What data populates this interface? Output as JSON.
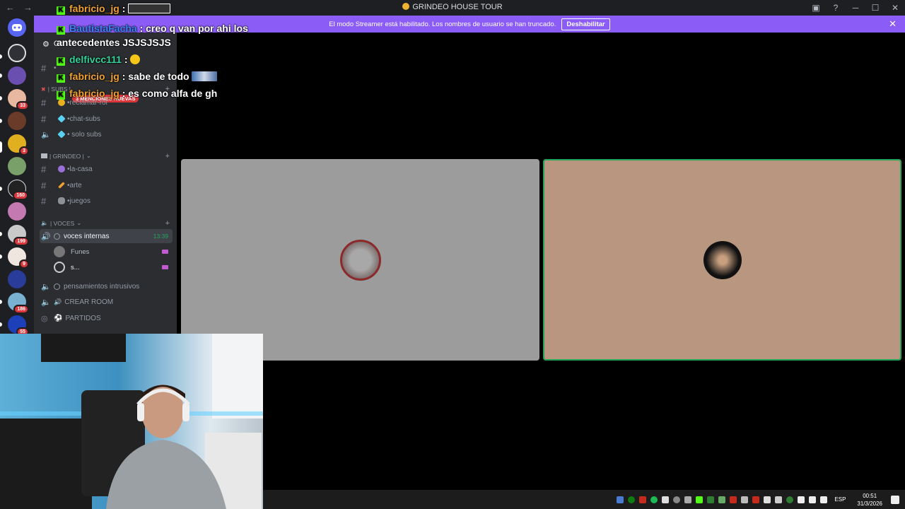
{
  "window": {
    "title": "GRINDEO HOUSE TOUR",
    "back_glyph": "←",
    "forward_glyph": "→",
    "controls": [
      "─",
      "☐",
      "✕"
    ]
  },
  "streamer_banner": {
    "text": "El modo Streamer está habilitado. Los nombres de usuario se han truncado.",
    "button": "Deshabilitar",
    "close": "✕"
  },
  "server_rail": {
    "badges": [
      "33",
      "3",
      "160",
      "199",
      "9",
      "186",
      "55"
    ]
  },
  "sidebar": {
    "guild_name": "Gr",
    "mentions_badge": "3 MENCIONES NUEVAS",
    "categories": {
      "subs": "| SUBS |",
      "grindeo": "| GRINDEO |",
      "voces": "| VOCES"
    },
    "channels": {
      "top": "•",
      "reclamar_rol": "•reclamar-rol",
      "chat_subs": "•chat-subs",
      "solo_subs": "• solo subs",
      "la_casa": "•la-casa",
      "arte": "•arte",
      "juegos": "•juegos",
      "voces_internas": "voces internas",
      "voces_internas_time": "13:39",
      "pensamientos": "pensamientos intrusivos",
      "crear_room": "CREAR ROOM",
      "partidos": "PARTIDOS"
    },
    "voice_users": [
      "Funes",
      "s..."
    ]
  },
  "chat_overlay": {
    "messages": [
      {
        "user": "fabricio_jg",
        "text": ":"
      },
      {
        "user": "BautistaFacha",
        "text": ": creo q van por ahi los"
      },
      {
        "user": "",
        "text": "antecedentes JSJSJSJS"
      },
      {
        "user": "delfivcc111",
        "text": ":"
      },
      {
        "user": "fabricio_jg",
        "text": ": sabe de todo"
      },
      {
        "user": "fabricio_jg",
        "text": ": es como alfa de gh"
      }
    ]
  },
  "taskbar": {
    "language": "ESP",
    "time": "00:51",
    "date": "31/3/2026"
  },
  "colors": {
    "banner": "#8b5cf6",
    "kick_green": "#53fc18",
    "speaking_border": "#23a55a",
    "badge_red": "#da373c"
  }
}
